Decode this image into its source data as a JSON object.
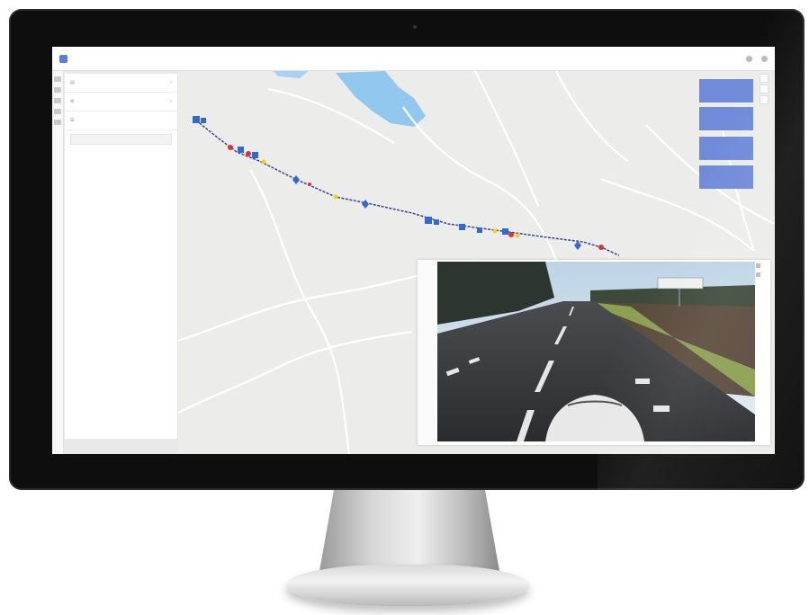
{
  "screen": {
    "header": {
      "app_name": "",
      "nav_items": []
    },
    "left_panel": {
      "rows": [
        {
          "icon": "layers-icon",
          "label": ""
        },
        {
          "icon": "filter-icon",
          "label": ""
        },
        {
          "icon": "list-icon",
          "label": ""
        }
      ]
    },
    "kpi_cards": [],
    "map": {
      "route_color": "#3a3f9e",
      "marker_colors": {
        "blue": "#2f6ad0",
        "red": "#e03131",
        "yellow": "#f2d21b"
      }
    },
    "viewer": {
      "photo": "road-street-view"
    },
    "accent_color": "#6f8bd9"
  }
}
